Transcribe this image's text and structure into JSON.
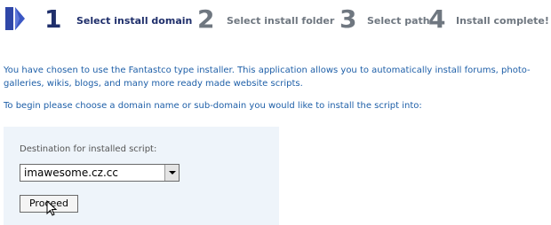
{
  "steps": [
    {
      "number": "1",
      "label": "Select install domain",
      "active": true
    },
    {
      "number": "2",
      "label": "Select install folder",
      "active": false
    },
    {
      "number": "3",
      "label": "Select path",
      "active": false
    },
    {
      "number": "4",
      "label": "Install complete!",
      "active": false
    }
  ],
  "intro": {
    "paragraph1": "You have chosen to use the Fantastco type installer. This application allows you to automatically install forums, photo-galleries, wikis, blogs, and many more ready made website scripts.",
    "paragraph2": "To begin please choose a domain name or sub-domain you would like to install the script into:"
  },
  "form": {
    "destination_label": "Destination for installed script:",
    "selected_domain": "imawesome.cz.cc",
    "proceed_label": "Proceed"
  },
  "icons": {
    "step_indicator": "arrow-right-icon",
    "cursor": "mouse-pointer-icon"
  },
  "colors": {
    "active_step": "#1f2f6b",
    "inactive_step": "#6f7780",
    "intro_text": "#1e5fa8",
    "panel_bg": "#eef4fa",
    "arrow_icon": "#3b4fb0"
  }
}
